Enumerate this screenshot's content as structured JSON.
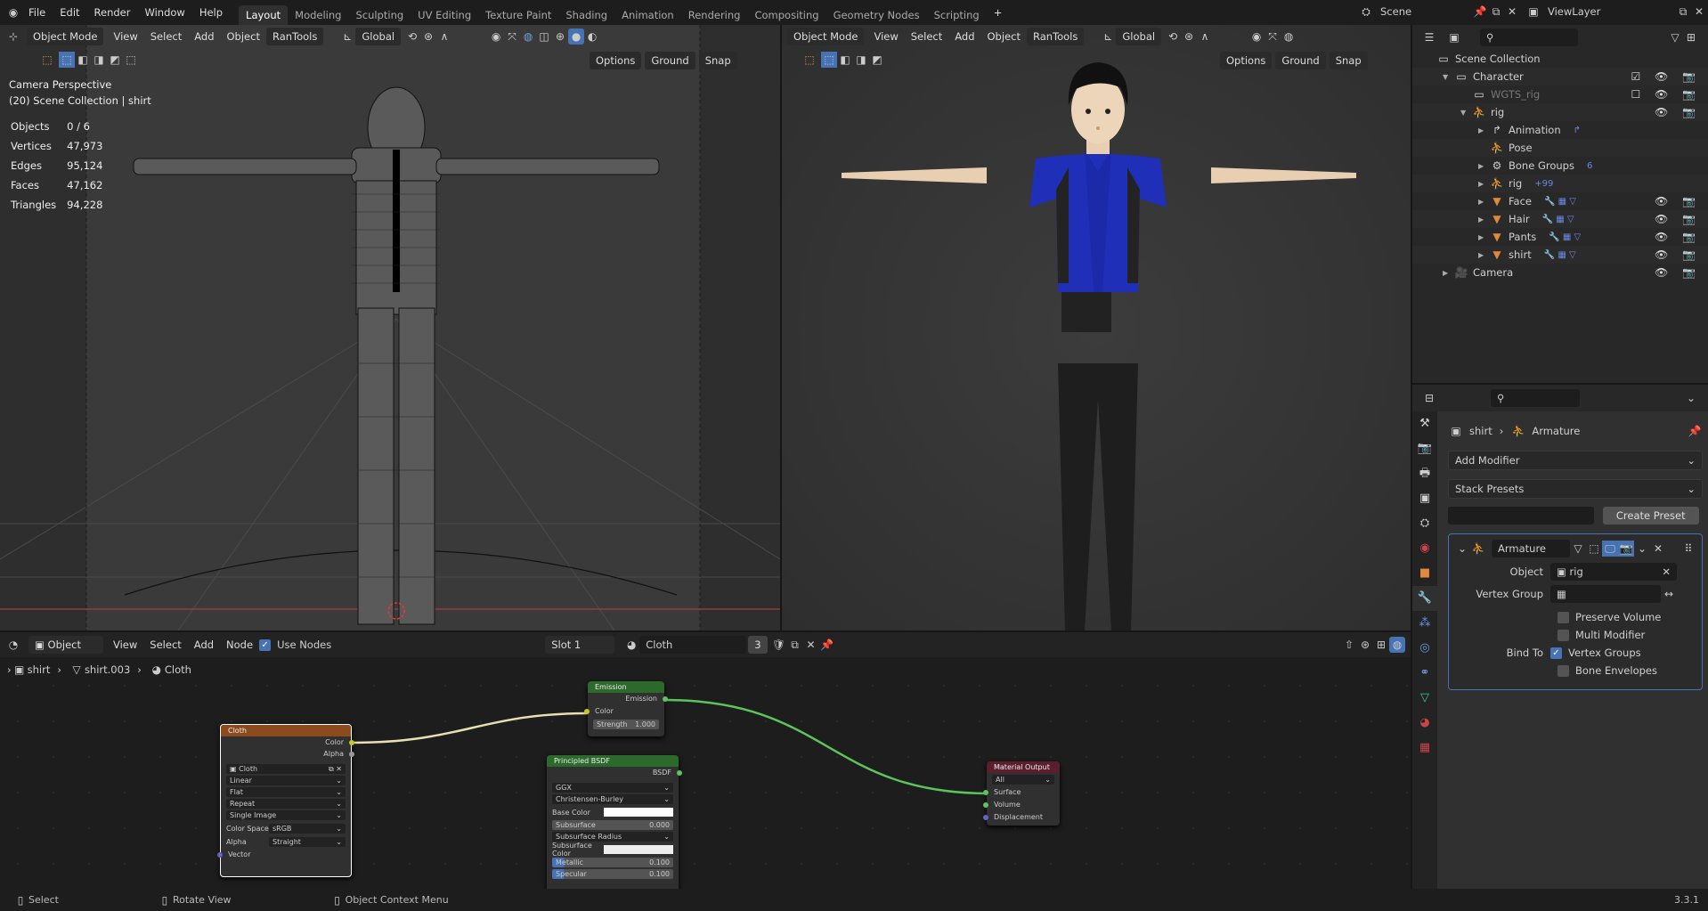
{
  "menubar": {
    "items": [
      "File",
      "Edit",
      "Render",
      "Window",
      "Help"
    ],
    "workspaces": [
      "Layout",
      "Modeling",
      "Sculpting",
      "UV Editing",
      "Texture Paint",
      "Shading",
      "Animation",
      "Rendering",
      "Compositing",
      "Geometry Nodes",
      "Scripting"
    ],
    "active_workspace": "Layout",
    "scene": "Scene",
    "view_layer": "ViewLayer"
  },
  "viewport_left": {
    "mode": "Object Mode",
    "menus": [
      "View",
      "Select",
      "Add",
      "Object"
    ],
    "addon": "RanTools",
    "orientation": "Global",
    "options": "Options",
    "ground": "Ground",
    "snap": "Snap",
    "view_name": "Camera Perspective",
    "collection_info": "(20) Scene Collection | shirt",
    "stats": [
      [
        "Objects",
        "0 / 6"
      ],
      [
        "Vertices",
        "47,973"
      ],
      [
        "Edges",
        "95,124"
      ],
      [
        "Faces",
        "47,162"
      ],
      [
        "Triangles",
        "94,228"
      ]
    ]
  },
  "viewport_right": {
    "mode": "Object Mode",
    "menus": [
      "View",
      "Select",
      "Add",
      "Object"
    ],
    "addon": "RanTools",
    "orientation": "Global",
    "options": "Options",
    "ground": "Ground",
    "snap": "Snap"
  },
  "outliner": {
    "rows": [
      {
        "label": "Scene Collection",
        "depth": 0,
        "icon": "collection-icon"
      },
      {
        "label": "Character",
        "depth": 1,
        "icon": "collection-icon",
        "vis": "☑ 👁 📷"
      },
      {
        "label": "WGTS_rig",
        "depth": 2,
        "icon": "collection-icon",
        "dim": true,
        "vis": "☐ 👁 📷"
      },
      {
        "label": "rig",
        "depth": 2,
        "icon": "armature-icon",
        "vis": "👁 📷"
      },
      {
        "label": "Animation",
        "depth": 3,
        "icon": "action-icon",
        "extra": "↱"
      },
      {
        "label": "Pose",
        "depth": 3,
        "icon": "pose-icon"
      },
      {
        "label": "Bone Groups",
        "depth": 3,
        "icon": "bone-groups-icon",
        "extra": "6"
      },
      {
        "label": "rig",
        "depth": 3,
        "icon": "pose-icon",
        "extra": "+99"
      },
      {
        "label": "Face",
        "depth": 3,
        "icon": "mesh-icon",
        "extra": "🔧 ▦ ▽",
        "vis": "👁 📷"
      },
      {
        "label": "Hair",
        "depth": 3,
        "icon": "mesh-icon",
        "extra": "🔧 ▦ ▽",
        "vis": "👁 📷"
      },
      {
        "label": "Pants",
        "depth": 3,
        "icon": "mesh-icon",
        "extra": "🔧 ▦ ▽",
        "vis": "👁 📷"
      },
      {
        "label": "shirt",
        "depth": 3,
        "icon": "mesh-icon",
        "extra": "🔧 ▦ ▽",
        "vis": "👁 📷"
      },
      {
        "label": "Camera",
        "depth": 1,
        "icon": "camera-icon",
        "vis": "👁 📷"
      }
    ]
  },
  "properties": {
    "breadcrumb_object": "shirt",
    "breadcrumb_modifier": "Armature",
    "add_modifier": "Add Modifier",
    "stack_presets": "Stack Presets",
    "preset_name": "",
    "create_preset": "Create Preset",
    "modifier": {
      "name": "Armature",
      "object_label": "Object",
      "object_value": "rig",
      "vertex_group_label": "Vertex Group",
      "vertex_group_value": "",
      "preserve_volume": "Preserve Volume",
      "multi_modifier": "Multi Modifier",
      "bind_to_label": "Bind To",
      "vertex_groups": "Vertex Groups",
      "bone_envelopes": "Bone Envelopes",
      "preserve_volume_checked": false,
      "multi_modifier_checked": false,
      "vertex_groups_checked": true,
      "bone_envelopes_checked": false
    }
  },
  "node_editor": {
    "type": "Object",
    "menus": [
      "View",
      "Select",
      "Add",
      "Node"
    ],
    "use_nodes": "Use Nodes",
    "slot": "Slot 1",
    "material": "Cloth",
    "users": "3",
    "breadcrumb": [
      "shirt",
      "shirt.003",
      "Cloth"
    ],
    "nodes": {
      "image": {
        "title": "Cloth",
        "outputs": [
          "Color",
          "Alpha"
        ],
        "image": "Cloth",
        "interpolation": "Linear",
        "projection": "Flat",
        "extension": "Repeat",
        "source": "Single Image",
        "color_space_label": "Color Space",
        "color_space": "sRGB",
        "alpha_label": "Alpha",
        "alpha": "Straight",
        "input": "Vector"
      },
      "emission": {
        "title": "Emission",
        "output": "Emission",
        "color": "Color",
        "strength_label": "Strength",
        "strength": "1.000"
      },
      "bsdf": {
        "title": "Principled BSDF",
        "output": "BSDF",
        "distribution": "GGX",
        "subsurface_method": "Christensen-Burley",
        "base_color": "Base Color",
        "subsurface": "Subsurface",
        "subsurface_value": "0.000",
        "subsurface_radius": "Subsurface Radius",
        "subsurface_color": "Subsurface Color",
        "metallic": "Metallic",
        "metallic_value": "0.100",
        "specular": "Specular",
        "specular_value": "0.100"
      },
      "output": {
        "title": "Material Output",
        "target": "All",
        "inputs": [
          "Surface",
          "Volume",
          "Displacement"
        ]
      }
    }
  },
  "statusbar": {
    "select": "Select",
    "rotate": "Rotate View",
    "context": "Object Context Menu",
    "version": "3.3.1"
  },
  "colors": {
    "accent": "#4772b3",
    "image_header": "#8b4b1c",
    "shader_header": "#2b6a2b",
    "output_header": "#5a1e2c",
    "shirt": "#1f2fb8"
  }
}
